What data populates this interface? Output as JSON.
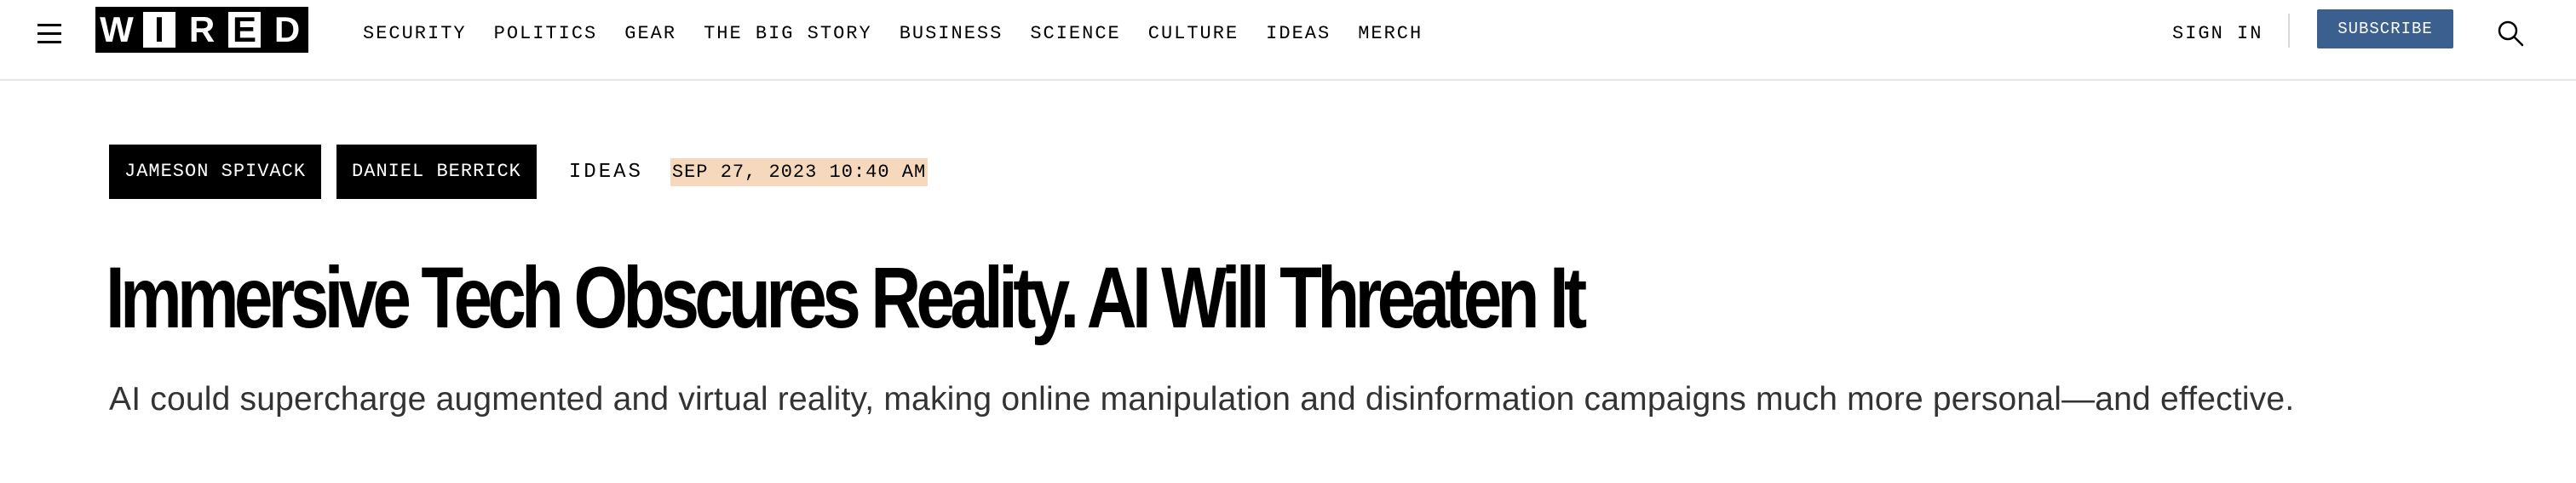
{
  "header": {
    "logo_letters": [
      "W",
      "I",
      "R",
      "E",
      "D"
    ],
    "nav": [
      "SECURITY",
      "POLITICS",
      "GEAR",
      "THE BIG STORY",
      "BUSINESS",
      "SCIENCE",
      "CULTURE",
      "IDEAS",
      "MERCH"
    ],
    "sign_in_label": "SIGN IN",
    "subscribe_label": "SUBSCRIBE",
    "icons": {
      "menu": "hamburger-icon",
      "search": "search-icon"
    },
    "subscribe_color": "#3b5f8f"
  },
  "article": {
    "authors": [
      "JAMESON SPIVACK",
      "DANIEL BERRICK"
    ],
    "rubric": "IDEAS",
    "date": "SEP 27, 2023 10:40 AM",
    "date_highlight_color": "#f6d8bd",
    "headline": "Immersive Tech Obscures Reality. AI Will Threaten It",
    "dek": "AI could supercharge augmented and virtual reality, making online manipulation and disinformation campaigns much more personal—and effective."
  }
}
